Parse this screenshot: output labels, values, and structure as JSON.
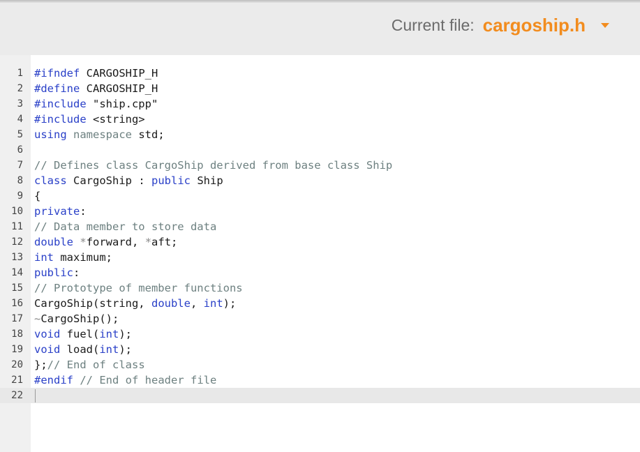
{
  "header": {
    "file_label": "Current file:",
    "file_name": "cargoship.h",
    "dropdown_icon": "caret-down-icon"
  },
  "editor": {
    "lines": [
      [
        {
          "t": "kw",
          "v": "#ifndef"
        },
        {
          "t": "tx",
          "v": " CARGOSHIP_H"
        }
      ],
      [
        {
          "t": "kw",
          "v": "#define"
        },
        {
          "t": "tx",
          "v": " CARGOSHIP_H"
        }
      ],
      [
        {
          "t": "kw",
          "v": "#include"
        },
        {
          "t": "tx",
          "v": " \"ship.cpp\""
        }
      ],
      [
        {
          "t": "kw",
          "v": "#include"
        },
        {
          "t": "tx",
          "v": " <string>"
        }
      ],
      [
        {
          "t": "kw",
          "v": "using"
        },
        {
          "t": "tx",
          "v": " "
        },
        {
          "t": "cm",
          "v": "namespace"
        },
        {
          "t": "tx",
          "v": " std;"
        }
      ],
      [],
      [
        {
          "t": "cm",
          "v": "// Defines class CargoShip derived from base class Ship"
        }
      ],
      [
        {
          "t": "kw",
          "v": "class"
        },
        {
          "t": "tx",
          "v": " CargoShip : "
        },
        {
          "t": "kw",
          "v": "public"
        },
        {
          "t": "tx",
          "v": " Ship"
        }
      ],
      [
        {
          "t": "tx",
          "v": "{"
        }
      ],
      [
        {
          "t": "kw",
          "v": "private"
        },
        {
          "t": "tx",
          "v": ":"
        }
      ],
      [
        {
          "t": "cm",
          "v": "// Data member to store data"
        }
      ],
      [
        {
          "t": "kw",
          "v": "double"
        },
        {
          "t": "tx",
          "v": " "
        },
        {
          "t": "op",
          "v": "*"
        },
        {
          "t": "tx",
          "v": "forward, "
        },
        {
          "t": "op",
          "v": "*"
        },
        {
          "t": "tx",
          "v": "aft;"
        }
      ],
      [
        {
          "t": "kw",
          "v": "int"
        },
        {
          "t": "tx",
          "v": " maximum;"
        }
      ],
      [
        {
          "t": "kw",
          "v": "public"
        },
        {
          "t": "tx",
          "v": ":"
        }
      ],
      [
        {
          "t": "cm",
          "v": "// Prototype of member functions"
        }
      ],
      [
        {
          "t": "tx",
          "v": "CargoShip(string, "
        },
        {
          "t": "kw",
          "v": "double"
        },
        {
          "t": "tx",
          "v": ", "
        },
        {
          "t": "kw",
          "v": "int"
        },
        {
          "t": "tx",
          "v": ");"
        }
      ],
      [
        {
          "t": "op",
          "v": "~"
        },
        {
          "t": "tx",
          "v": "CargoShip();"
        }
      ],
      [
        {
          "t": "kw",
          "v": "void"
        },
        {
          "t": "tx",
          "v": " fuel("
        },
        {
          "t": "kw",
          "v": "int"
        },
        {
          "t": "tx",
          "v": ");"
        }
      ],
      [
        {
          "t": "kw",
          "v": "void"
        },
        {
          "t": "tx",
          "v": " load("
        },
        {
          "t": "kw",
          "v": "int"
        },
        {
          "t": "tx",
          "v": ");"
        }
      ],
      [
        {
          "t": "tx",
          "v": "};"
        },
        {
          "t": "cm",
          "v": "// End of class"
        }
      ],
      [
        {
          "t": "kw",
          "v": "#endif"
        },
        {
          "t": "tx",
          "v": " "
        },
        {
          "t": "cm",
          "v": "// End of header file"
        }
      ],
      []
    ],
    "active_line": 22
  },
  "colors": {
    "accent": "#f28c1e",
    "keyword": "#2a40c8",
    "comment": "#6d8080",
    "header_bg": "#ebebeb",
    "gutter_bg": "#f0f0f0"
  }
}
